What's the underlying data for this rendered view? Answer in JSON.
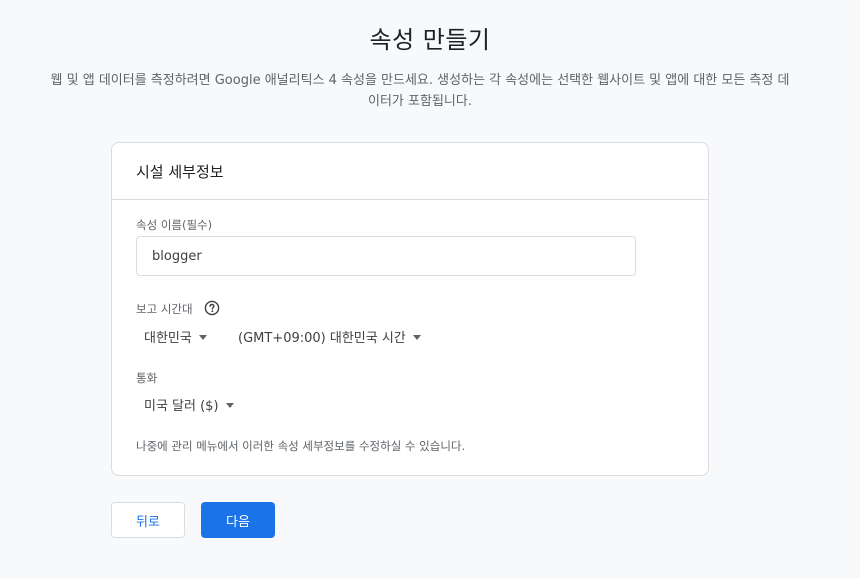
{
  "page": {
    "title": "속성 만들기",
    "subtitle_line1": "웹 및 앱 데이터를 측정하려면 Google 애널리틱스 4 속성을 만드세요. 생성하는 각 속성에는 선택한 웹사이트 및 앱에 대한 모든 측정 데",
    "subtitle_line2": "이터가 포함됩니다."
  },
  "card": {
    "header": "시설 세부정보",
    "property_name": {
      "label": "속성 이름(필수)",
      "value": "blogger"
    },
    "reporting_timezone": {
      "label": "보고 시간대",
      "help_icon": "help-circle-icon",
      "country": "대한민국",
      "timezone": "(GMT+09:00) 대한민국 시간"
    },
    "currency": {
      "label": "통화",
      "value": "미국 달러 ($)"
    },
    "note": "나중에 관리 메뉴에서 이러한 속성 세부정보를 수정하실 수 있습니다."
  },
  "buttons": {
    "back_label": "뒤로",
    "next_label": "다음"
  },
  "colors": {
    "accent": "#1a73e8",
    "border": "#dadce0",
    "background": "#f8f9fa"
  }
}
